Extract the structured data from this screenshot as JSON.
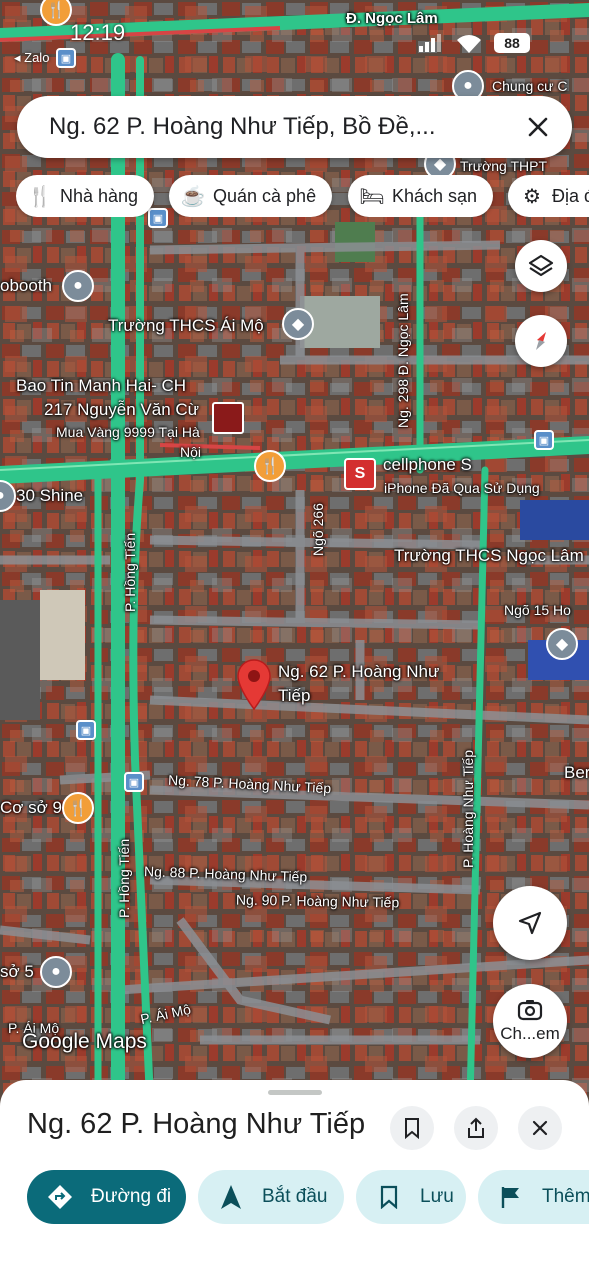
{
  "status_bar": {
    "time": "12:19",
    "back_app": "◂ Zalo",
    "battery": "88"
  },
  "search": {
    "value": "Ng. 62 P. Hoàng Như Tiếp, Bồ Đề,..."
  },
  "chips": [
    {
      "label": "Nhà hàng",
      "icon": "restaurant-icon"
    },
    {
      "label": "Quán cà phê",
      "icon": "coffee-icon"
    },
    {
      "label": "Khách sạn",
      "icon": "hotel-icon"
    },
    {
      "label": "Địa đ",
      "icon": "attraction-icon"
    }
  ],
  "map": {
    "labels": {
      "road_top": "Đ. Ngọc Lâm",
      "chung_cu": "Chung cư C",
      "truong_thpt": "Trường THPT",
      "booth": "obooth",
      "thcs_ai_mo": "Trường THCS Ái Mộ",
      "ngo_298": "Ng. 298 Đ. Ngọc Lâm",
      "bao_tin_1": "Bao Tin Manh Hai- CH",
      "bao_tin_2": "217 Nguyễn Văn Cừ",
      "bao_tin_sub1": "Mua Vàng 9999 Tại Hà",
      "bao_tin_sub2": "Nội",
      "cellphone": "cellphone S",
      "cellphone_sub": "iPhone Đã Qua Sử Dụng",
      "shine": "30 Shine",
      "ngo_266": "Ngõ 266",
      "hong_tien_1": "P. Hồng Tiến",
      "hong_tien_2": "P. Hồng Tiến",
      "thcs_ngoc_lam": "Trường THCS Ngọc Lâm",
      "ngo_15": "Ngõ 15 Ho",
      "pin_label_1": "Ng. 62 P. Hoàng Như",
      "pin_label_2": "Tiếp",
      "ngo_78": "Ng. 78 P. Hoàng Như Tiếp",
      "ngo_88": "Ng. 88 P. Hoàng Như Tiếp",
      "ngo_90": "Ng. 90 P. Hoàng Như Tiếp",
      "hoang_nhu_tiep": "P. Hoàng Như Tiếp",
      "co_so_9": "Cơ sở 9",
      "co_so_5": "sở 5",
      "ber": "Ber",
      "ai_mo_1": "P. Ái Mộ",
      "ai_mo_2": "P. Ái Mộ",
      "cellphone_logo": "S"
    },
    "google_logo": "Google Maps"
  },
  "fabs": {
    "camera_label": "Ch...em"
  },
  "sheet": {
    "title": "Ng. 62 P. Hoàng Như Tiếp",
    "actions": [
      {
        "label": "Đường đi",
        "icon": "directions-icon"
      },
      {
        "label": "Bắt đầu",
        "icon": "navigation-icon"
      },
      {
        "label": "Lưu",
        "icon": "bookmark-icon"
      },
      {
        "label": "Thêm",
        "icon": "flag-icon"
      }
    ]
  },
  "colors": {
    "road_green": "#2fc58a",
    "primary_action": "#0b6b7a",
    "secondary_action": "#d7f0f3",
    "pin_red": "#e53935"
  }
}
